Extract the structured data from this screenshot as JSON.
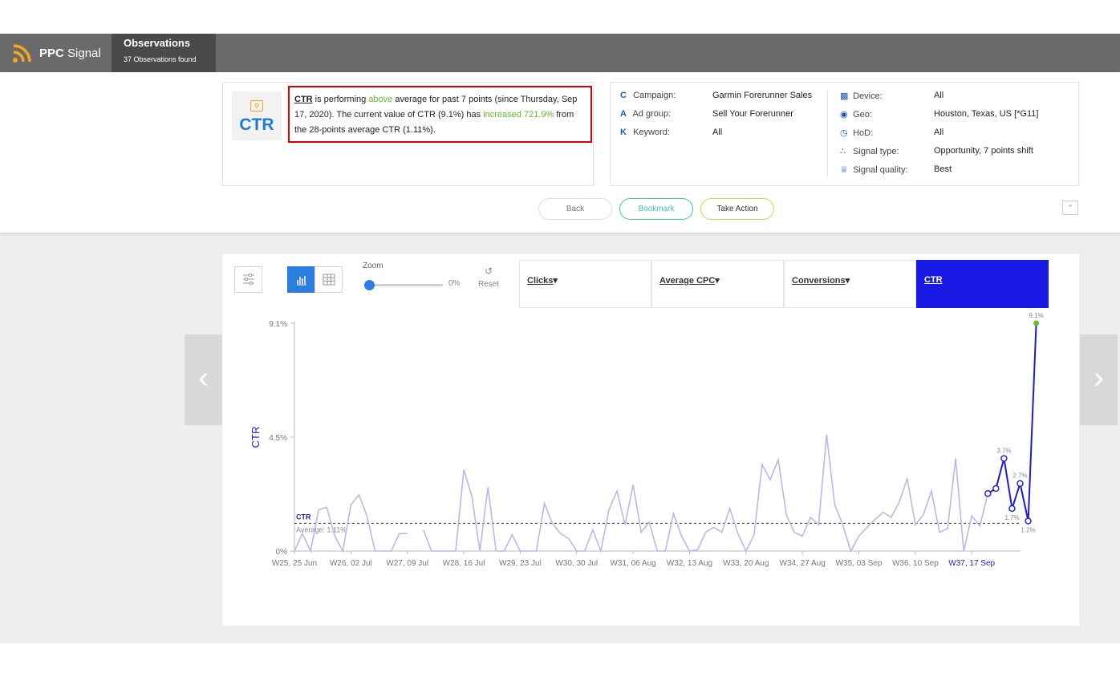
{
  "header": {
    "brand_bold": "PPC",
    "brand_light": "Signal",
    "observations_title": "Observations",
    "observations_count": "37 Observations found"
  },
  "alert": {
    "metric_icon_text": "CTR",
    "metric": "CTR",
    "t1": " is performing ",
    "direction": "above",
    "t2": " average for past 7 points (since Thursday, Sep 17, 2020). The current value of CTR (9.1%) has ",
    "change": "increased 721.9%",
    "t3": " from the 28-points average CTR (1.11%)."
  },
  "properties": {
    "campaign_label": "Campaign:",
    "campaign_value": "Garmin Forerunner Sales",
    "adgroup_label": "Ad group:",
    "adgroup_value": "Sell Your Forerunner",
    "keyword_label": "Keyword:",
    "keyword_value": "All",
    "device_label": "Device:",
    "device_value": "All",
    "geo_label": "Geo:",
    "geo_value": "Houston, Texas, US [*G11]",
    "hod_label": "HoD:",
    "hod_value": "All",
    "signal_type_label": "Signal type:",
    "signal_type_value": "Opportunity, 7 points shift",
    "signal_quality_label": "Signal quality:",
    "signal_quality_value": "Best"
  },
  "actions": {
    "back": "Back",
    "bookmark": "Bookmark",
    "take_action": "Take Action"
  },
  "controls": {
    "zoom_label": "Zoom",
    "zoom_value": "0%",
    "zoom_fraction": 0,
    "reset": "Reset"
  },
  "metric_tabs": {
    "clicks": "Clicks",
    "avg_cpc": "Average CPC",
    "conversions": "Conversions",
    "ctr": "CTR",
    "active": "CTR"
  },
  "colors": {
    "accent": "#1a1ae6",
    "history_line": "#b8b8f0",
    "highlight_green": "#5fbe29",
    "alert_border": "#d60000"
  },
  "chart_data": {
    "type": "line",
    "ylabel": "CTR",
    "y_unit": "%",
    "ylim": [
      0,
      9.1
    ],
    "y_ticks": [
      "0%",
      "4.5%",
      "9.1%"
    ],
    "x_ticks": [
      "W25, 25 Jun",
      "W26, 02 Jul",
      "W27, 09 Jul",
      "W28, 16 Jul",
      "W29, 23 Jul",
      "W30, 30 Jul",
      "W31, 06 Aug",
      "W32, 13 Aug",
      "W33, 20 Aug",
      "W34, 27 Aug",
      "W35, 03 Sep",
      "W36, 10 Sep",
      "W37, 17 Sep"
    ],
    "highlight_tick": "W37, 17 Sep",
    "average_label": "CTR",
    "average_text": "Average: 1.11%",
    "average": 1.11,
    "series": [
      {
        "role": "history",
        "values": [
          0,
          0.7,
          0,
          1.65,
          1.75,
          0.6,
          0,
          1.85,
          2.25,
          1.4,
          0,
          0,
          0,
          0.7,
          0.7,
          null,
          0.85,
          0,
          0,
          0,
          0,
          3.25,
          2.2,
          0,
          2.55,
          0,
          0,
          0.65,
          0,
          0,
          0,
          1.9,
          1.1,
          0.7,
          0.5,
          0,
          0,
          0.85,
          0,
          1.65,
          2.4,
          1.05,
          2.65,
          0.75,
          1.15,
          0,
          0,
          1.5,
          0.6,
          0,
          0.05,
          0.75,
          0.95,
          0.75,
          1.7,
          0.7,
          0,
          0.65,
          3.45,
          2.85,
          3.65,
          1.45,
          0.75,
          0.6,
          1.35,
          1.05,
          4.65,
          1.85,
          1.05,
          0,
          0.6,
          0.95,
          1.25,
          1.55,
          1.35,
          1.95,
          2.9,
          1.05,
          1.45,
          2.4,
          0.75,
          0.9,
          3.7,
          0,
          1.4,
          1.0,
          2.3
        ]
      },
      {
        "role": "recent",
        "values": [
          2.3,
          2.5,
          3.7,
          1.7,
          2.7,
          1.2,
          9.1
        ],
        "point_labels": [
          "",
          "",
          "3.7%",
          "1.7%",
          "2.7%",
          "1.2%",
          "9.1%"
        ]
      }
    ]
  }
}
